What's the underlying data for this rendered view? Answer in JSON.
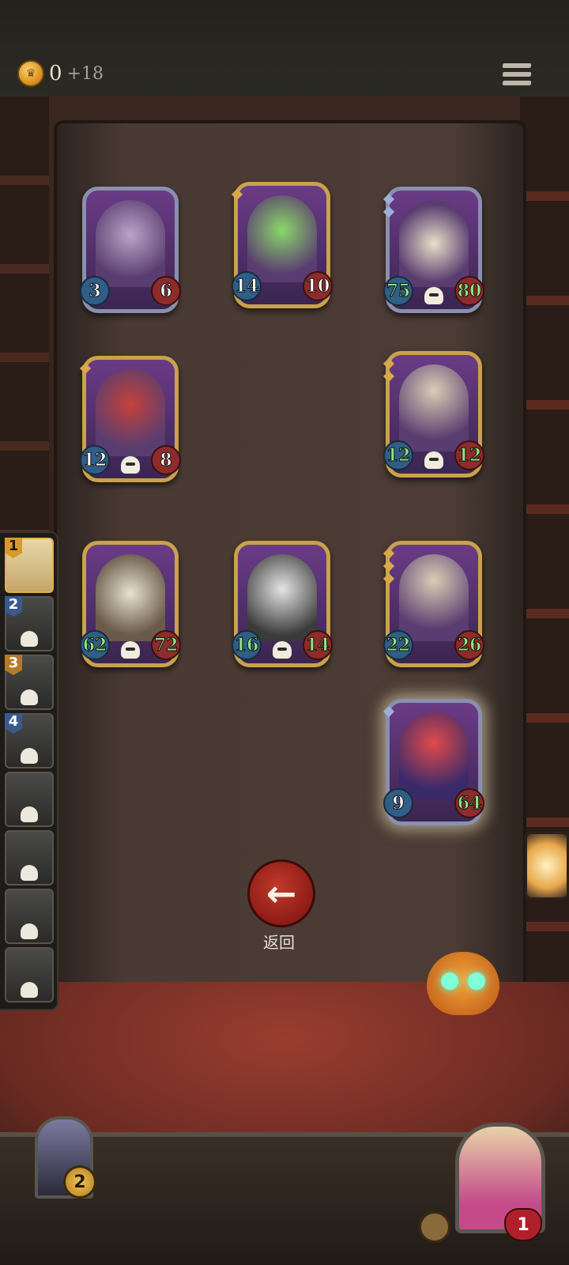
{
  "hud": {
    "gold": "0",
    "gold_income": "+18"
  },
  "cards": [
    {
      "id": "knight",
      "atk": "3",
      "hp": "6",
      "atk_buff": false,
      "hp_buff": false,
      "frame": "silver",
      "skull": false
    },
    {
      "id": "pumpkin-golem",
      "atk": "14",
      "hp": "10",
      "atk_buff": false,
      "hp_buff": false,
      "frame": "gold",
      "skull": false
    },
    {
      "id": "clock-clown",
      "atk": "75",
      "hp": "80",
      "atk_buff": true,
      "hp_buff": true,
      "frame": "silver",
      "skull": true
    },
    {
      "id": "red-dragon",
      "atk": "12",
      "hp": "8",
      "atk_buff": false,
      "hp_buff": false,
      "frame": "gold",
      "skull": true
    },
    {
      "id": "zeppelin-1",
      "atk": "12",
      "hp": "12",
      "atk_buff": true,
      "hp_buff": true,
      "frame": "gold",
      "skull": true
    },
    {
      "id": "bone-dragon",
      "atk": "62",
      "hp": "72",
      "atk_buff": true,
      "hp_buff": true,
      "frame": "gold",
      "skull": true
    },
    {
      "id": "cyclops-butler",
      "atk": "16",
      "hp": "14",
      "atk_buff": true,
      "hp_buff": true,
      "frame": "gold",
      "skull": true
    },
    {
      "id": "zeppelin-2",
      "atk": "22",
      "hp": "26",
      "atk_buff": true,
      "hp_buff": true,
      "frame": "gold",
      "skull": false
    },
    {
      "id": "clown-jester",
      "atk": "9",
      "hp": "64",
      "atk_buff": false,
      "hp_buff": true,
      "frame": "silver",
      "skull": false
    }
  ],
  "opponents": [
    {
      "rank": "1"
    },
    {
      "rank": "2"
    },
    {
      "rank": "3"
    },
    {
      "rank": "4"
    },
    {
      "rank": ""
    },
    {
      "rank": ""
    },
    {
      "rank": ""
    },
    {
      "rank": ""
    }
  ],
  "actions": {
    "back_label": "返回",
    "back_icon": "←"
  },
  "player": {
    "tavern_tier": "2",
    "health": "1"
  }
}
